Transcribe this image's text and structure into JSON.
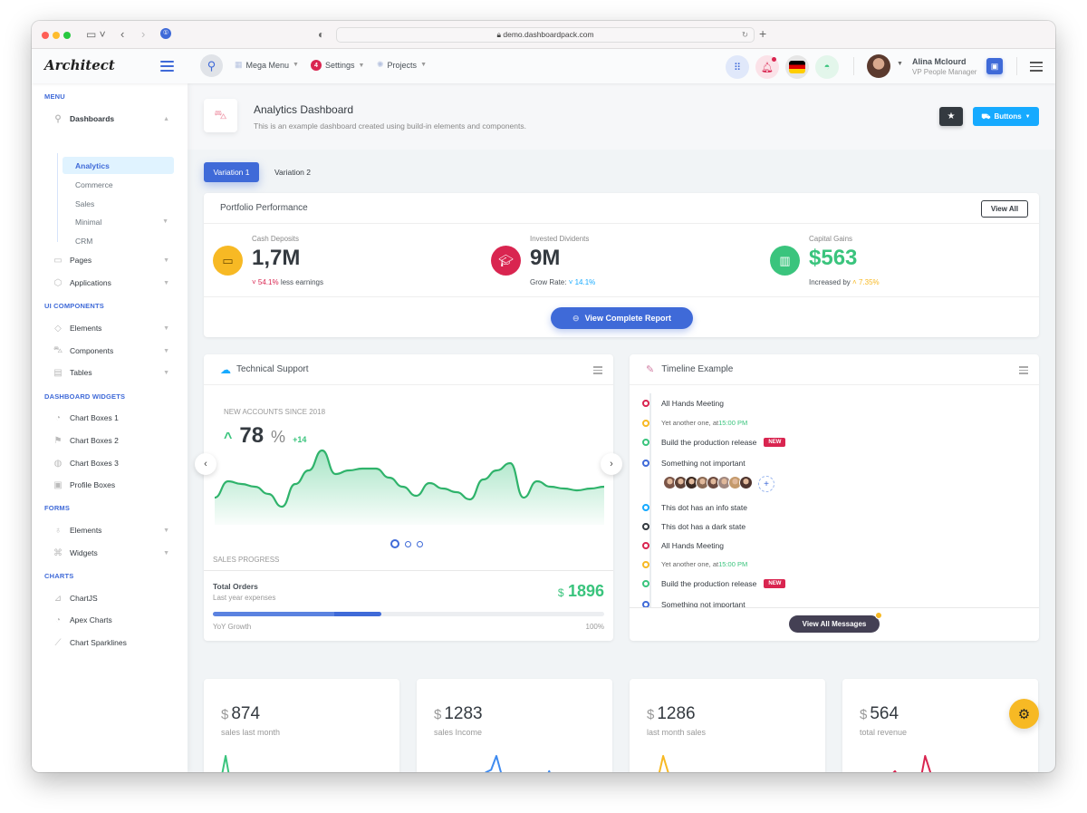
{
  "browser": {
    "url": "demo.dashboardpack.com",
    "traffic_lights": [
      "#ff5f57",
      "#febc2e",
      "#28c840"
    ]
  },
  "header": {
    "logo": "Architect",
    "nav": [
      {
        "label": "Mega Menu",
        "icon": "gift-icon"
      },
      {
        "label": "Settings",
        "badge": "4"
      },
      {
        "label": "Projects",
        "icon": "gear-icon"
      }
    ],
    "user": {
      "name": "Alina Mclourd",
      "role": "VP People Manager"
    }
  },
  "sidebar": {
    "sections": [
      {
        "heading": "MENU"
      },
      {
        "heading": "UI COMPONENTS"
      },
      {
        "heading": "DASHBOARD WIDGETS"
      },
      {
        "heading": "FORMS"
      },
      {
        "heading": "CHARTS"
      }
    ],
    "dashboards": {
      "label": "Dashboards",
      "children": [
        "Analytics",
        "Commerce",
        "Sales",
        "Minimal",
        "CRM"
      ],
      "active": "Analytics"
    },
    "menu_items": [
      "Pages",
      "Applications"
    ],
    "ui_items": [
      "Elements",
      "Components",
      "Tables"
    ],
    "widget_items": [
      "Chart Boxes 1",
      "Chart Boxes 2",
      "Chart Boxes 3",
      "Profile Boxes"
    ],
    "form_items": [
      "Elements",
      "Widgets"
    ],
    "chart_items": [
      "ChartJS",
      "Apex Charts",
      "Chart Sparklines"
    ]
  },
  "page": {
    "title": "Analytics Dashboard",
    "subtitle": "This is an example dashboard created using build-in elements and components.",
    "buttons_label": "Buttons",
    "tabs": [
      "Variation 1",
      "Variation 2"
    ]
  },
  "portfolio": {
    "title": "Portfolio Performance",
    "view_all": "View All",
    "kpis": [
      {
        "label": "Cash Deposits",
        "value": "1,7M",
        "delta": "54.1%",
        "delta_text": "less earnings",
        "color": "#f7b924"
      },
      {
        "label": "Invested Dividents",
        "value": "9M",
        "prefix": "Grow Rate:",
        "delta": "14.1%",
        "color": "#d92550"
      },
      {
        "label": "Capital Gains",
        "value": "$563",
        "prefix": "Increased by",
        "delta": "7.35%",
        "color": "#3ac47d"
      }
    ],
    "report_button": "View Complete Report"
  },
  "support": {
    "title": "Technical Support",
    "caption": "NEW ACCOUNTS SINCE 2018",
    "value": "78",
    "unit": "%",
    "change": "+14",
    "sales_progress": "SALES PROGRESS",
    "total_orders": "Total Orders",
    "expenses": "Last year expenses",
    "amount_symbol": "$",
    "amount": "1896",
    "growth_label": "YoY Growth",
    "growth_max": "100%",
    "progress_fraction": 0.43
  },
  "timeline": {
    "title": "Timeline Example",
    "new_label": "NEW",
    "items": [
      {
        "text": "All Hands Meeting",
        "color": "#d92550"
      },
      {
        "text": "Yet another one, at ",
        "time": "15:00 PM",
        "color": "#f7b924"
      },
      {
        "text": "Build the production release",
        "new": true,
        "color": "#3ac47d"
      },
      {
        "text": "Something not important",
        "color": "#3f6ad8"
      },
      {
        "text": "This dot has an info state",
        "color": "#16aaff"
      },
      {
        "text": "This dot has a dark state",
        "color": "#343a40"
      },
      {
        "text": "All Hands Meeting",
        "color": "#d92550"
      },
      {
        "text": "Yet another one, at ",
        "time": "15:00 PM",
        "color": "#f7b924"
      },
      {
        "text": "Build the production release",
        "new": true,
        "color": "#3ac47d"
      },
      {
        "text": "Something not important",
        "color": "#3f6ad8"
      }
    ],
    "button": "View All Messages"
  },
  "stats": [
    {
      "symbol": "$",
      "value": "874",
      "label": "sales last month",
      "color": "#3ac47d"
    },
    {
      "symbol": "$",
      "value": "1283",
      "label": "sales Income",
      "color": "#3f8bf0"
    },
    {
      "symbol": "$",
      "value": "1286",
      "label": "last month sales",
      "color": "#f7b924"
    },
    {
      "symbol": "$",
      "value": "564",
      "label": "total revenue",
      "color": "#d92550"
    }
  ],
  "colors": {
    "primary": "#3f6ad8",
    "success": "#3ac47d",
    "danger": "#d92550",
    "warning": "#f7b924",
    "info": "#16aaff",
    "dark": "#343a40"
  }
}
